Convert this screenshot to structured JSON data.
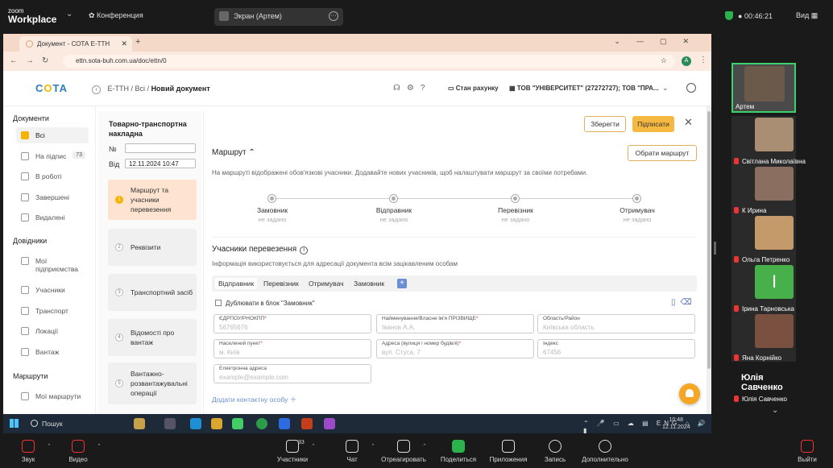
{
  "zoom": {
    "logo_top": "zoom",
    "logo_bottom": "Workplace",
    "conference": "Конференция",
    "share_title": "Экран (Артем)",
    "timer": "00:46:21",
    "view": "Вид",
    "bottom": {
      "audio": "Звук",
      "video": "Видео",
      "participants": "Участники",
      "participants_count": "33",
      "chat": "Чат",
      "react": "Отреагировать",
      "share": "Поделиться",
      "apps": "Приложения",
      "record": "Запись",
      "more": "Дополнительно",
      "exit": "Выйти"
    }
  },
  "participants": [
    {
      "name": "Артем",
      "muted": false
    },
    {
      "name": "Світлана Миколаївна",
      "muted": true
    },
    {
      "name": "К Ирина",
      "muted": true
    },
    {
      "name": "Ольга Петренко",
      "muted": true
    },
    {
      "name": "Ірина Тарновська",
      "muted": true,
      "letter": "I"
    },
    {
      "name": "Яна Корнійко",
      "muted": true
    },
    {
      "name": "Юлія Савченко",
      "muted": true,
      "big_name": "Юлія Савченко"
    }
  ],
  "browser": {
    "tab_title": "Документ - СОТА Е-ТТН",
    "url": "ettn.sota-buh.com.ua/doc/ettn/0",
    "account_letter": "A"
  },
  "app": {
    "logo_a": "С",
    "logo_b": "О",
    "logo_c": "ТА",
    "crumb_1": "Е-ТТН",
    "crumb_2": "Всі",
    "crumb_cur": "Новий документ",
    "stan": "Стан рахунку",
    "org": "ТОВ \"УНІВЕРСИТЕТ\" (27272727); ТОВ \"ПРА..."
  },
  "sidebar": {
    "sec_docs": "Документи",
    "docs": [
      {
        "label": "Всі",
        "active": true
      },
      {
        "label": "На підпис",
        "count": "73"
      },
      {
        "label": "В роботі"
      },
      {
        "label": "Завершені"
      },
      {
        "label": "Видалені"
      }
    ],
    "sec_refs": "Довідники",
    "refs": [
      {
        "label": "Мої підприємства"
      },
      {
        "label": "Учасники"
      },
      {
        "label": "Транспорт"
      },
      {
        "label": "Локації"
      },
      {
        "label": "Вантаж"
      }
    ],
    "sec_routes": "Маршрути",
    "routes": [
      {
        "label": "Мої маршрути"
      }
    ]
  },
  "steps": {
    "doctype": "Товарно-транспортна накладна",
    "num_label": "№",
    "num_value": "",
    "date_label": "Від",
    "date_value": "12.11.2024 10:47",
    "items": [
      {
        "n": "1",
        "label": "Маршрут та учасники перевезення",
        "active": true
      },
      {
        "n": "2",
        "label": "Реквізити"
      },
      {
        "n": "3",
        "label": "Транспортний засіб"
      },
      {
        "n": "4",
        "label": "Відомості про вантаж"
      },
      {
        "n": "5",
        "label": "Вантажно-розвантажувальні операції"
      }
    ]
  },
  "main": {
    "save": "Зберегти",
    "sign": "Підписати",
    "route_title": "Маршрут",
    "route_button": "Обрати маршрут",
    "route_desc": "На маршруті відображені обов'язкові учасники. Додавайте нових учасників, щоб налаштувати маршрут за своїми потребами.",
    "route_points": [
      {
        "label": "Замовник",
        "status": "не задано"
      },
      {
        "label": "Відправник",
        "status": "не задано"
      },
      {
        "label": "Перевізник",
        "status": "не задано"
      },
      {
        "label": "Отримувач",
        "status": "не задано"
      }
    ],
    "parties_title": "Учасники перевезення",
    "parties_desc": "Інформація використовується для адресації документа всім зацікавленим особам",
    "tabs": [
      "Відправник",
      "Перевізник",
      "Отримувач",
      "Замовник"
    ],
    "duplicate": "Дублювати в блок \"Замовник\"",
    "fields": {
      "edrpou": {
        "label": "ЄДРПОУ/РНОКПП",
        "placeholder": "56765676"
      },
      "name": {
        "label": "Найменування/Власне ім'я ПРІЗВИЩЕ",
        "placeholder": "Іванов А.А."
      },
      "region": {
        "label": "Область/Район",
        "placeholder": "Київська область"
      },
      "city": {
        "label": "Населений пункт",
        "placeholder": "м. Київ"
      },
      "address": {
        "label": "Адреса (вулиця і номер будівлі)",
        "placeholder": "вул. Стуса, 7"
      },
      "index": {
        "label": "Індекс",
        "placeholder": "67456"
      },
      "email": {
        "label": "Електронна адреса",
        "placeholder": "example@example.com"
      }
    },
    "add_contact": "Додати контактну особу"
  },
  "taskbar": {
    "search": "Пошук",
    "lang": "ENG",
    "time": "10:48",
    "date": "12.11.2024"
  }
}
